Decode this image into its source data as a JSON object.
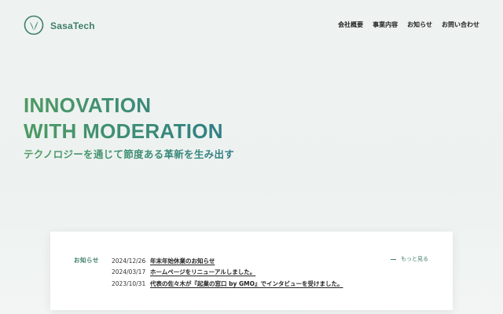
{
  "header": {
    "logo_text": "SasaTech",
    "nav": [
      {
        "label": "会社概要"
      },
      {
        "label": "事業内容"
      },
      {
        "label": "お知らせ"
      },
      {
        "label": "お問い合わせ"
      }
    ]
  },
  "hero": {
    "line1": "INNOVATION",
    "line2": "WITH MODERATION",
    "subtitle": "テクノロジーを通じて節度ある革新を生み出す"
  },
  "news": {
    "heading": "お知らせ",
    "more_label": "もっと見る",
    "items": [
      {
        "date": "2024/12/26",
        "title": "年末年始休業のお知らせ"
      },
      {
        "date": "2024/03/17",
        "title": "ホームページをリニューアルしました。"
      },
      {
        "date": "2023/10/31",
        "title": "代表の佐々木が『起業の窓口 by GMO』でインタビューを受けました。"
      }
    ]
  },
  "colors": {
    "brand_green": "#3e7f69",
    "gradient_start": "#4f9a62",
    "gradient_end": "#2f7d86"
  },
  "icons": {
    "logo": "leaf-circle-icon"
  }
}
